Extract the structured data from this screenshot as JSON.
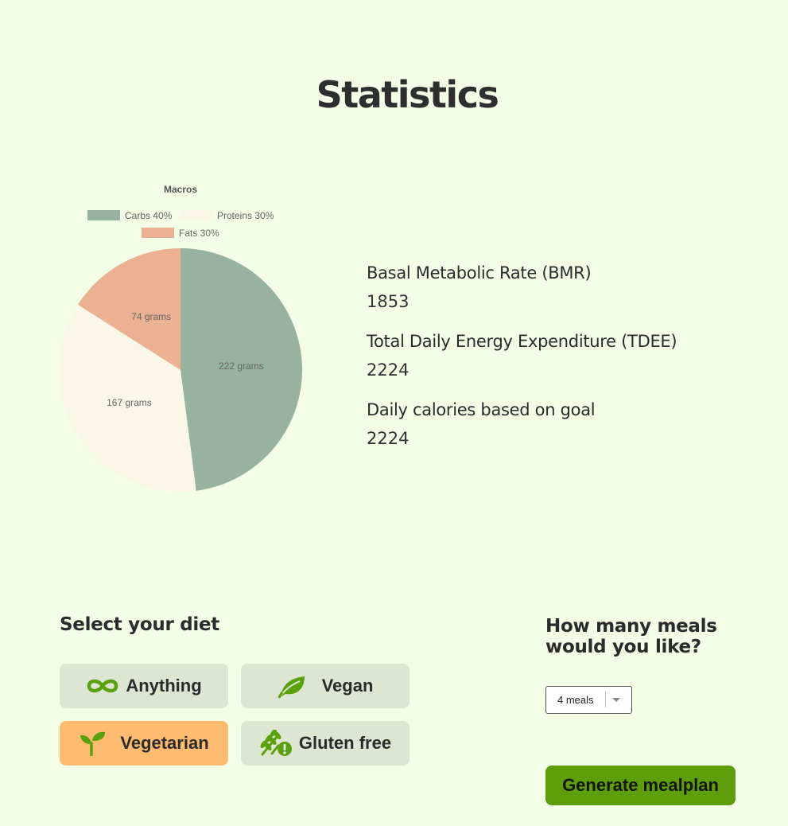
{
  "page": {
    "title": "Statistics"
  },
  "colors": {
    "background": "#f4fde6",
    "carbs": "#97b3a0",
    "proteins": "#fbf7e8",
    "fats": "#ebb192",
    "diet_button": "#dde5d3",
    "diet_button_active": "#ffbb70",
    "accent_green": "#5e9e0a",
    "icon_green": "#5aa00f"
  },
  "chart_data": {
    "type": "pie",
    "title": "Macros",
    "categories": [
      "Carbs 40%",
      "Proteins 30%",
      "Fats 30%"
    ],
    "values": [
      222,
      167,
      74
    ],
    "slice_labels": [
      "222 grams",
      "167 grams",
      "74 grams"
    ],
    "colors": [
      "#97b3a0",
      "#fbf7e8",
      "#ebb192"
    ],
    "legend_position": "top"
  },
  "stats": [
    {
      "label": "Basal Metabolic Rate (BMR)",
      "value": "1853"
    },
    {
      "label": "Total Daily Energy Expenditure (TDEE)",
      "value": "2224"
    },
    {
      "label": "Daily calories based on goal",
      "value": "2224"
    }
  ],
  "diet": {
    "heading": "Select your diet",
    "options": [
      {
        "label": "Anything",
        "icon": "infinity-icon",
        "selected": false
      },
      {
        "label": "Vegan",
        "icon": "leaf-icon",
        "selected": false
      },
      {
        "label": "Vegetarian",
        "icon": "sprout-icon",
        "selected": true
      },
      {
        "label": "Gluten free",
        "icon": "wheat-warning-icon",
        "selected": false
      }
    ]
  },
  "meals": {
    "heading": "How many meals would you like?",
    "selected": "4 meals"
  },
  "actions": {
    "generate_label": "Generate mealplan"
  }
}
